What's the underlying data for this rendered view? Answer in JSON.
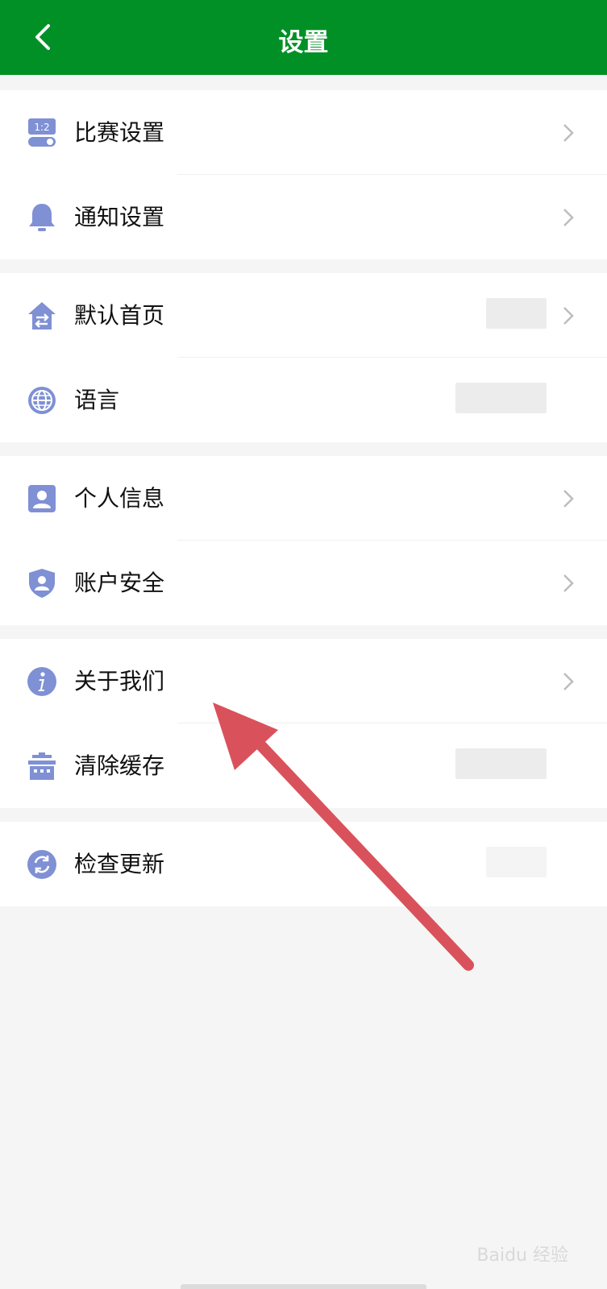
{
  "header": {
    "title": "设置"
  },
  "groups": [
    {
      "items": [
        {
          "label": "比赛设置",
          "icon": "match-settings-icon"
        },
        {
          "label": "通知设置",
          "icon": "bell-icon"
        }
      ]
    },
    {
      "items": [
        {
          "label": "默认首页",
          "icon": "home-switch-icon"
        },
        {
          "label": "语言",
          "icon": "globe-icon"
        }
      ]
    },
    {
      "items": [
        {
          "label": "个人信息",
          "icon": "user-card-icon"
        },
        {
          "label": "账户安全",
          "icon": "shield-user-icon"
        }
      ]
    },
    {
      "items": [
        {
          "label": "关于我们",
          "icon": "info-icon"
        },
        {
          "label": "清除缓存",
          "icon": "basket-icon"
        }
      ]
    },
    {
      "items": [
        {
          "label": "检查更新",
          "icon": "refresh-icon"
        }
      ]
    }
  ],
  "colors": {
    "header_bg": "#009026",
    "icon": "#7f90d4",
    "annotation_arrow": "#d9525b"
  },
  "watermark": "Baidu 经验"
}
